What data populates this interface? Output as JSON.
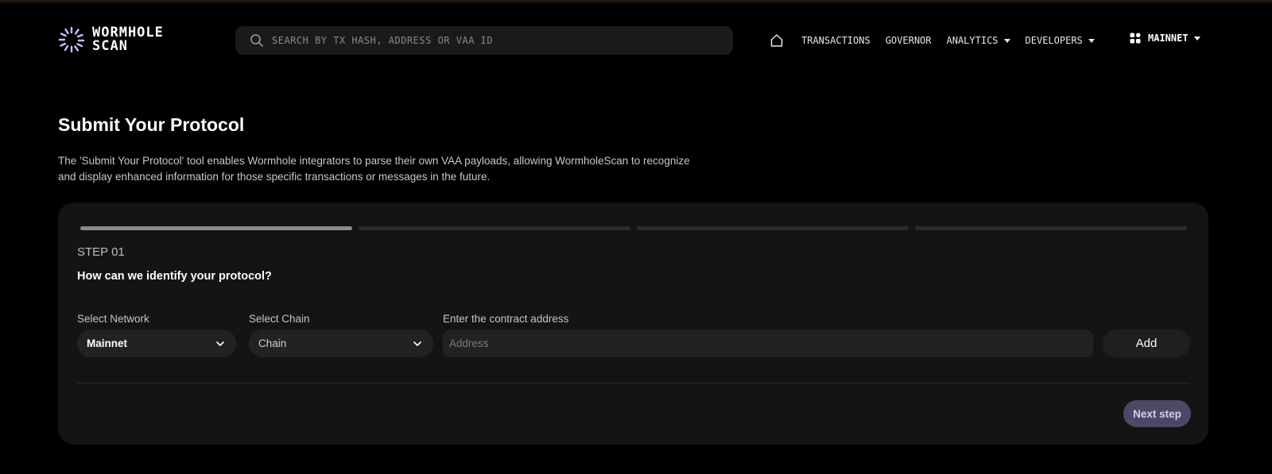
{
  "header": {
    "logo_line1": "WORMHOLE",
    "logo_line2": "SCAN",
    "search_placeholder": "SEARCH BY TX HASH, ADDRESS OR VAA ID",
    "nav": {
      "home_icon": "home-icon",
      "transactions": "TRANSACTIONS",
      "governor": "GOVERNOR",
      "analytics": "ANALYTICS",
      "developers": "DEVELOPERS"
    },
    "network_label": "MAINNET"
  },
  "page": {
    "title": "Submit Your Protocol",
    "description": "The 'Submit Your Protocol' tool enables Wormhole integrators to parse their own VAA payloads, allowing WormholeScan to recognize and display enhanced information for those specific transactions or messages in the future."
  },
  "wizard": {
    "total_steps": 4,
    "current_step": 1,
    "step_label": "STEP 01",
    "question": "How can we identify your protocol?",
    "network_field": {
      "label": "Select Network",
      "value": "Mainnet"
    },
    "chain_field": {
      "label": "Select Chain",
      "value": "Chain"
    },
    "address_field": {
      "label": "Enter the contract address",
      "placeholder": "Address",
      "value": ""
    },
    "add_label": "Add",
    "next_label": "Next step"
  },
  "colors": {
    "background": "#000000",
    "card": "#141414",
    "field": "#222222",
    "accent_button": "#4c4868",
    "logo_accent": "#b6a6ff"
  }
}
